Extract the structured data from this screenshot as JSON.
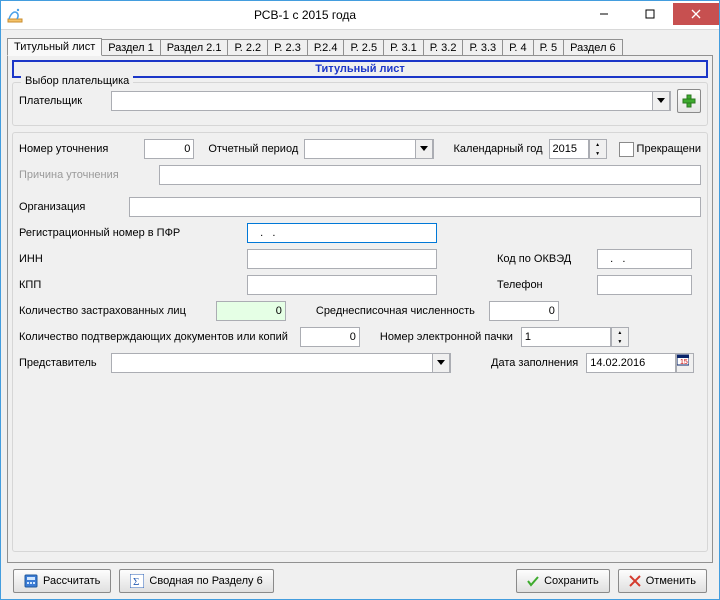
{
  "window": {
    "title": "РСВ-1 с 2015 года"
  },
  "tabs": [
    "Титульный лист",
    "Раздел 1",
    "Раздел 2.1",
    "Р. 2.2",
    "Р. 2.3",
    "Р.2.4",
    "Р. 2.5",
    "Р. 3.1",
    "Р. 3.2",
    "Р. 3.3",
    "Р. 4",
    "Р. 5",
    "Раздел 6"
  ],
  "section_title": "Титульный лист",
  "group_payer_title": "Выбор плательщика",
  "labels": {
    "payer": "Плательщик",
    "correction_number": "Номер уточнения",
    "report_period": "Отчетный период",
    "calendar_year": "Календарный год",
    "terminated": "Прекращени",
    "correction_reason": "Причина уточнения",
    "organization": "Организация",
    "reg_number_pfr": "Регистрационный номер в ПФР",
    "inn": "ИНН",
    "okved": "Код по ОКВЭД",
    "kpp": "КПП",
    "phone": "Телефон",
    "insured_count": "Количество застрахованных лиц",
    "avg_headcount": "Среднесписочная численность",
    "supporting_docs": "Количество подтверждающих документов или копий",
    "epack_number": "Номер электронной пачки",
    "representative": "Представитель",
    "fill_date": "Дата заполнения"
  },
  "values": {
    "correction_number": "0",
    "calendar_year": "2015",
    "reg_number_pfr": "   .   .",
    "okved": "   .   .",
    "insured_count": "0",
    "avg_headcount": "0",
    "supporting_docs": "0",
    "epack_number": "1",
    "fill_date": "14.02.2016"
  },
  "buttons": {
    "calculate": "Рассчитать",
    "summary6": "Сводная по Разделу 6",
    "save": "Сохранить",
    "cancel": "Отменить"
  }
}
